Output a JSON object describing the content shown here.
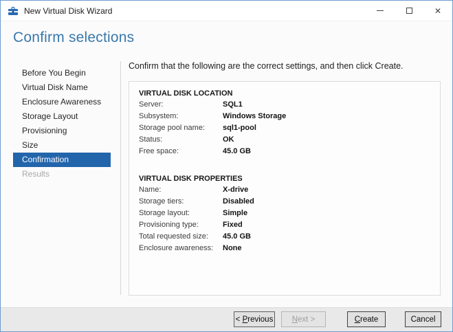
{
  "window": {
    "title": "New Virtual Disk Wizard",
    "close_glyph": "✕",
    "icons": {
      "app": "toolbox-wizard-icon",
      "minimize": "css-line",
      "maximize": "css-square",
      "close": "unicode-x"
    }
  },
  "colors": {
    "heading_accent": "#3878ab",
    "active_step_bg": "#2265ab",
    "window_border": "#6b9bd0",
    "footer_bg": "#e9e9e9"
  },
  "heading": "Confirm selections",
  "sidebar": {
    "items": [
      {
        "label": "Before You Begin",
        "state": "normal"
      },
      {
        "label": "Virtual Disk Name",
        "state": "normal"
      },
      {
        "label": "Enclosure Awareness",
        "state": "normal"
      },
      {
        "label": "Storage Layout",
        "state": "normal"
      },
      {
        "label": "Provisioning",
        "state": "normal"
      },
      {
        "label": "Size",
        "state": "normal"
      },
      {
        "label": "Confirmation",
        "state": "active"
      },
      {
        "label": "Results",
        "state": "disabled"
      }
    ]
  },
  "content": {
    "instruction": "Confirm that the following are the correct settings, and then click Create.",
    "sections": [
      {
        "title": "VIRTUAL DISK LOCATION",
        "rows": [
          {
            "label": "Server:",
            "value": "SQL1"
          },
          {
            "label": "Subsystem:",
            "value": "Windows Storage"
          },
          {
            "label": "Storage pool name:",
            "value": "sql1-pool"
          },
          {
            "label": "Status:",
            "value": "OK"
          },
          {
            "label": "Free space:",
            "value": "45.0 GB"
          }
        ]
      },
      {
        "title": "VIRTUAL DISK PROPERTIES",
        "rows": [
          {
            "label": "Name:",
            "value": "X-drive"
          },
          {
            "label": "Storage tiers:",
            "value": "Disabled"
          },
          {
            "label": "Storage layout:",
            "value": "Simple"
          },
          {
            "label": "Provisioning type:",
            "value": "Fixed"
          },
          {
            "label": "Total requested size:",
            "value": "45.0 GB"
          },
          {
            "label": "Enclosure awareness:",
            "value": "None"
          }
        ]
      }
    ]
  },
  "footer": {
    "previous": {
      "prefix": "< ",
      "accel": "P",
      "rest": "revious"
    },
    "next": {
      "accel": "N",
      "rest": "ext >"
    },
    "create": {
      "accel": "C",
      "rest": "reate"
    },
    "cancel": {
      "label": "Cancel"
    }
  }
}
